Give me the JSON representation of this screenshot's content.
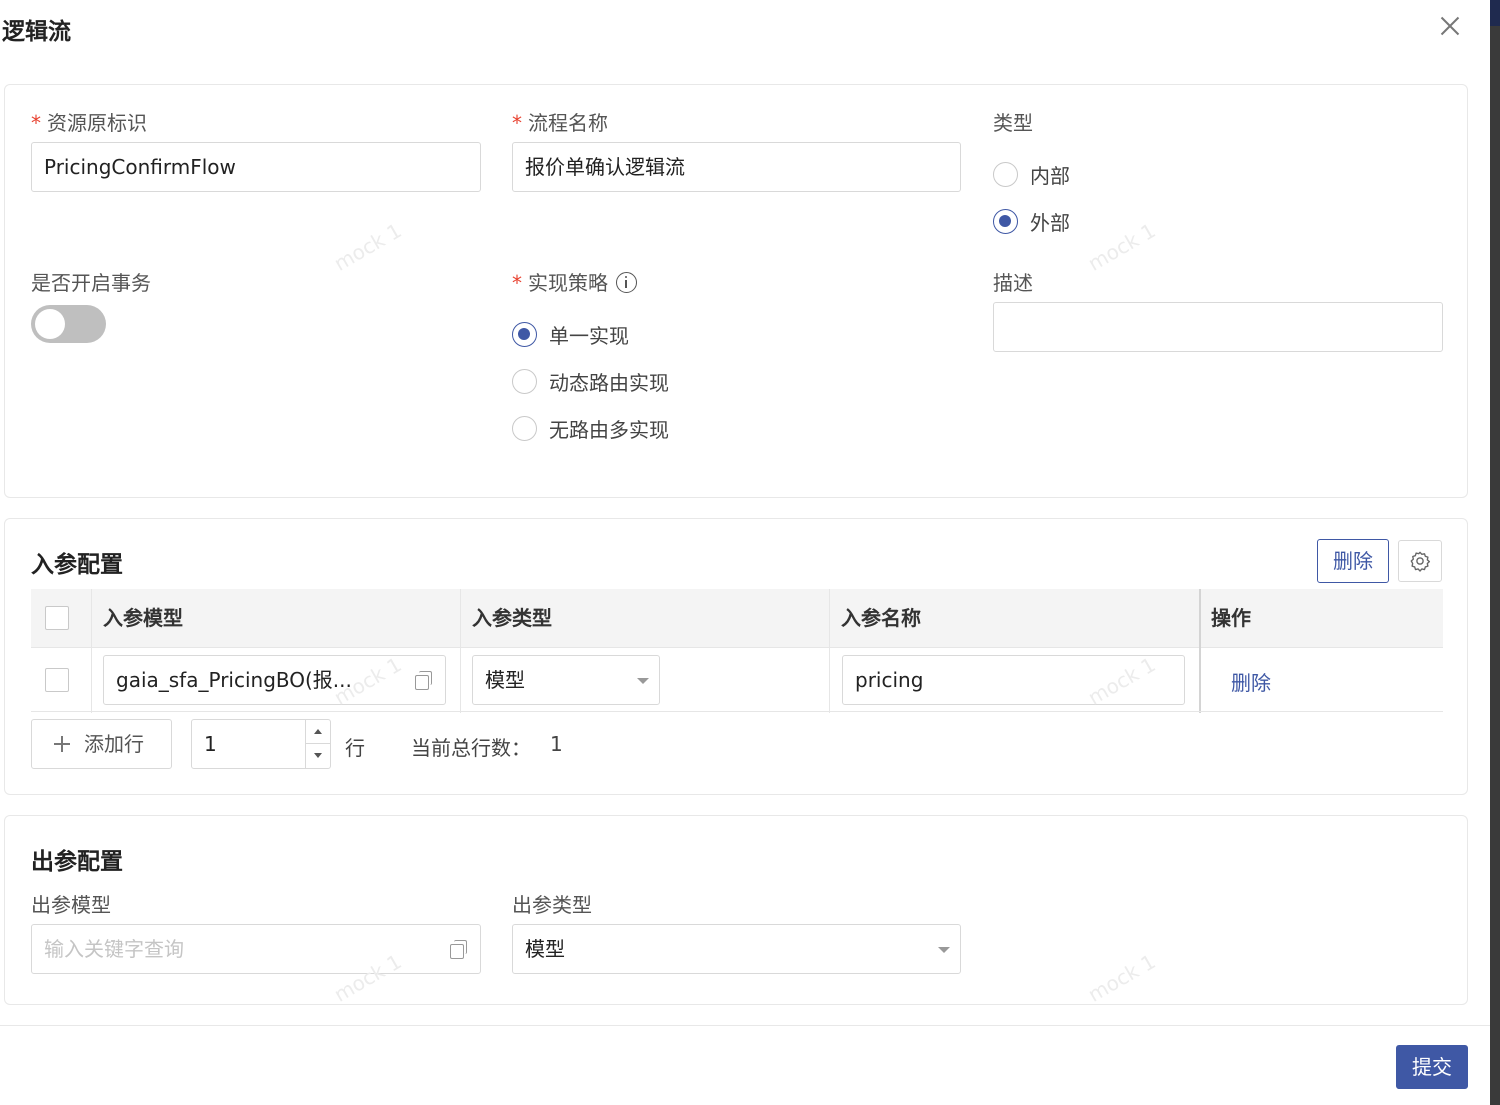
{
  "dialog": {
    "title": "逻辑流"
  },
  "basic": {
    "resource_id": {
      "label": "资源原标识",
      "value": "PricingConfirmFlow"
    },
    "flow_name": {
      "label": "流程名称",
      "value": "报价单确认逻辑流"
    },
    "type": {
      "label": "类型",
      "options": [
        "内部",
        "外部"
      ],
      "selected": "外部"
    },
    "transaction": {
      "label": "是否开启事务",
      "enabled": false
    },
    "strategy": {
      "label": "实现策略",
      "options": [
        "单一实现",
        "动态路由实现",
        "无路由多实现"
      ],
      "selected": "单一实现"
    },
    "description": {
      "label": "描述",
      "value": ""
    }
  },
  "input_params": {
    "title": "入参配置",
    "delete_label": "删除",
    "columns": [
      "入参模型",
      "入参类型",
      "入参名称",
      "操作"
    ],
    "rows": [
      {
        "model": "gaia_sfa_PricingBO(报...",
        "type": "模型",
        "name": "pricing",
        "action": "删除"
      }
    ],
    "add_row_label": "添加行",
    "row_count_value": "1",
    "row_unit": "行",
    "total_label": "当前总行数：",
    "total_value": "1"
  },
  "output_params": {
    "title": "出参配置",
    "model_label": "出参模型",
    "model_placeholder": "输入关键字查询",
    "type_label": "出参类型",
    "type_value": "模型"
  },
  "footer": {
    "submit_label": "提交"
  },
  "colors": {
    "accent": "#3f58a5",
    "required": "#e8412f"
  }
}
